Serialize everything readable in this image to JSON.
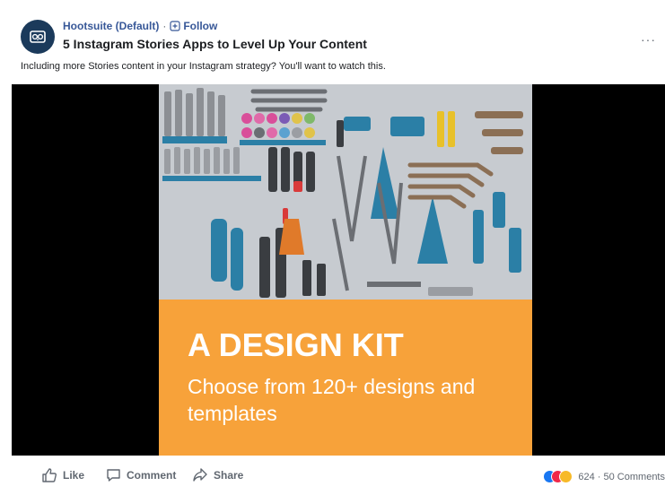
{
  "header": {
    "page_name": "Hootsuite (Default)",
    "separator": "·",
    "follow_label": "Follow",
    "post_title": "5 Instagram Stories Apps to Level Up Your Content",
    "more_label": "···"
  },
  "description": "Including more Stories content in your Instagram strategy? You'll want to watch this.",
  "media": {
    "image_description_icon": "tools-flatlay-image",
    "banner_heading": "A DESIGN KIT",
    "banner_subtitle": "Choose from 120+ designs and templates",
    "banner_color": "#f7a23a"
  },
  "actions": {
    "like_label": "Like",
    "comment_label": "Comment",
    "share_label": "Share"
  },
  "reactions": {
    "icons": [
      "like-reaction-icon",
      "love-reaction-icon",
      "wow-reaction-icon"
    ],
    "summary": "624 · 50 Comments"
  },
  "colors": {
    "link_blue": "#385898",
    "avatar_bg": "#1b3a5b"
  }
}
